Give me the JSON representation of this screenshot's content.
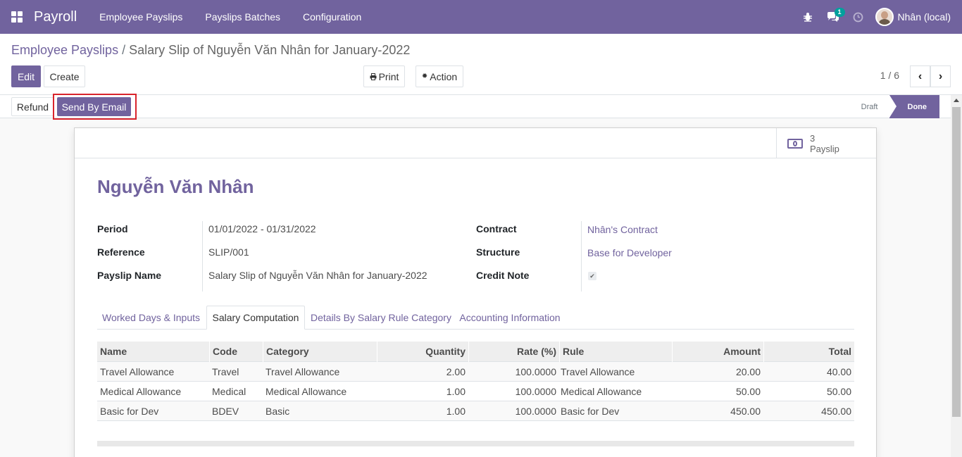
{
  "navbar": {
    "app_name": "Payroll",
    "menu": [
      "Employee Payslips",
      "Payslips Batches",
      "Configuration"
    ],
    "chat_count": "1",
    "user_name": "Nhân (local)",
    "accent": "#71639e"
  },
  "control": {
    "breadcrumb_parent": "Employee Payslips",
    "breadcrumb_separator": "/",
    "breadcrumb_current": "Salary Slip of Nguyễn Văn Nhân for January-2022",
    "edit_label": "Edit",
    "create_label": "Create",
    "print_label": "Print",
    "action_label": "Action",
    "pager": "1 / 6"
  },
  "statusbar": {
    "refund_label": "Refund",
    "send_email_label": "Send By Email",
    "steps": [
      "Draft",
      "Done"
    ],
    "active_step": "Done"
  },
  "sheet": {
    "smart_button": {
      "count": "3",
      "label": "Payslip",
      "icon": "money-icon"
    },
    "employee_name": "Nguyễn Văn Nhân",
    "left_fields": [
      {
        "label": "Period",
        "value": "01/01/2022 - 01/31/2022"
      },
      {
        "label": "Reference",
        "value": "SLIP/001"
      },
      {
        "label": "Payslip Name",
        "value": "Salary Slip of Nguyễn Văn Nhân for January-2022"
      }
    ],
    "right_fields": [
      {
        "label": "Contract",
        "value": "Nhân's Contract"
      },
      {
        "label": "Structure",
        "value": "Base for Developer"
      },
      {
        "label": "Credit Note",
        "value": ""
      }
    ],
    "tabs": [
      "Worked Days & Inputs",
      "Salary Computation",
      "Details By Salary Rule Category",
      "Accounting Information"
    ],
    "active_tab": "Salary Computation",
    "table": {
      "headers": [
        "Name",
        "Code",
        "Category",
        "Quantity",
        "Rate (%)",
        "Rule",
        "Amount",
        "Total"
      ],
      "rows": [
        [
          "Travel Allowance",
          "Travel",
          "Travel Allowance",
          "2.00",
          "100.0000",
          "Travel Allowance",
          "20.00",
          "40.00"
        ],
        [
          "Medical Allowance",
          "Medical",
          "Medical Allowance",
          "1.00",
          "100.0000",
          "Medical Allowance",
          "50.00",
          "50.00"
        ],
        [
          "Basic for Dev",
          "BDEV",
          "Basic",
          "1.00",
          "100.0000",
          "Basic for Dev",
          "450.00",
          "450.00"
        ]
      ]
    }
  }
}
